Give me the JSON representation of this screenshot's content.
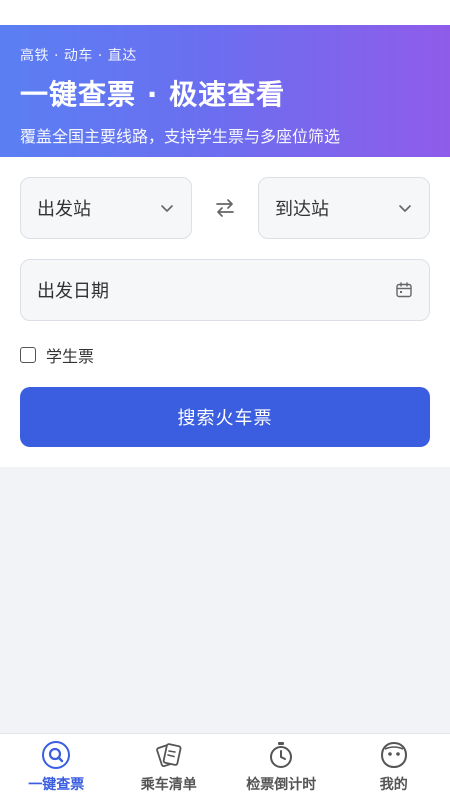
{
  "hero": {
    "tags": "高铁 · 动车 · 直达",
    "title": "一键查票 · 极速查看",
    "subtitle": "覆盖全国主要线路，支持学生票与多座位筛选"
  },
  "form": {
    "from_station": "出发站",
    "to_station": "到达站",
    "date": "出发日期",
    "student_label": "学生票",
    "student_checked": false,
    "search_label": "搜索火车票"
  },
  "tabbar": {
    "active_color": "#3b5ee0",
    "items": [
      {
        "label": "一键查票",
        "icon": "search-icon",
        "active": true
      },
      {
        "label": "乘车清单",
        "icon": "ticket-list-icon",
        "active": false
      },
      {
        "label": "检票倒计时",
        "icon": "stopwatch-icon",
        "active": false
      },
      {
        "label": "我的",
        "icon": "profile-face-icon",
        "active": false
      }
    ]
  }
}
